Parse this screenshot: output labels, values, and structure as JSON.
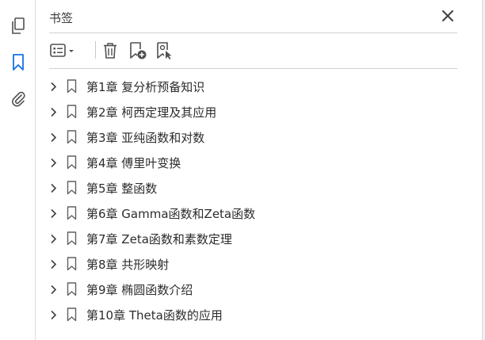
{
  "panel": {
    "title": "书签"
  },
  "rail": {
    "items": [
      {
        "icon": "pages-icon",
        "active": false
      },
      {
        "icon": "bookmark-icon",
        "active": true
      },
      {
        "icon": "attachment-icon",
        "active": false
      }
    ]
  },
  "toolbar": {
    "tools": [
      "options-menu-icon",
      "delete-bookmark-icon",
      "new-bookmark-icon",
      "bookmark-from-selection-icon"
    ]
  },
  "bookmarks": [
    {
      "label": "第1章  复分析预备知识"
    },
    {
      "label": "第2章  柯西定理及其应用"
    },
    {
      "label": "第3章  亚纯函数和对数"
    },
    {
      "label": "第4章  傅里叶变换"
    },
    {
      "label": "第5章  整函数"
    },
    {
      "label": "第6章  Gamma函数和Zeta函数"
    },
    {
      "label": "第7章  Zeta函数和素数定理"
    },
    {
      "label": "第8章  共形映射"
    },
    {
      "label": "第9章  椭圆函数介绍"
    },
    {
      "label": "第10章  Theta函数的应用"
    }
  ],
  "colors": {
    "accent": "#1473e6",
    "icon": "#505050",
    "text": "#2c2c2c"
  }
}
